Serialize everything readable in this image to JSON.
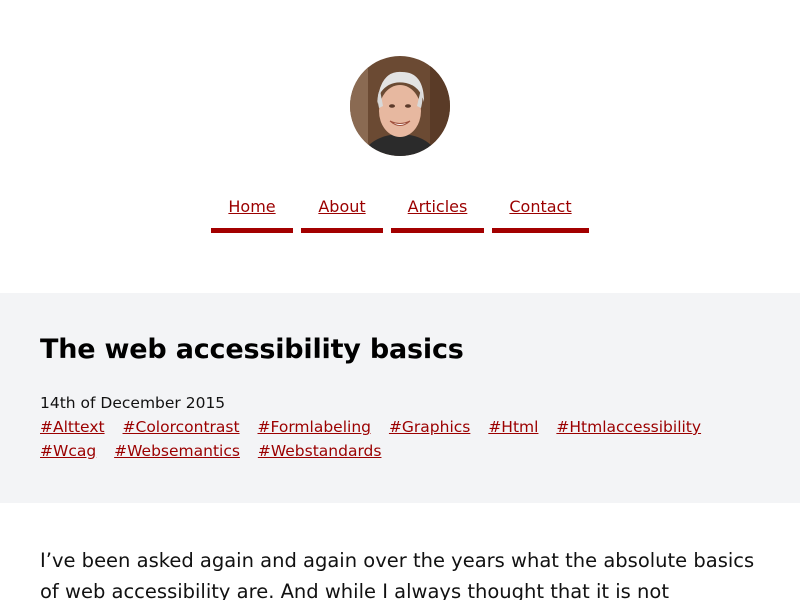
{
  "header": {
    "avatar_label": "Author photo",
    "nav": [
      {
        "label": "Home"
      },
      {
        "label": "About"
      },
      {
        "label": "Articles"
      },
      {
        "label": "Contact"
      }
    ]
  },
  "article": {
    "title": "The web accessibility basics",
    "date": "14th of December 2015",
    "tags": [
      "#Alttext",
      "#Colorcontrast",
      "#Formlabeling",
      "#Graphics",
      "#Html",
      "#Htmlaccessibility",
      "#Wcag",
      "#Websemantics",
      "#Webstandards"
    ],
    "intro": "I’ve been asked again and again over the years what the absolute basics of web accessibility are. And while I always thought that it is not"
  },
  "colors": {
    "link": "#9b0000",
    "nav_underline": "#a30000",
    "band_background": "#f3f4f6",
    "text": "#111111"
  }
}
